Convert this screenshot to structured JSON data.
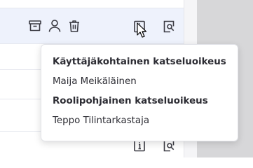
{
  "icons": {
    "archive": "archive-icon",
    "user": "user-icon",
    "delete": "trash-icon",
    "info": "info-icon",
    "preview": "document-search-icon",
    "cursor": "mouse-pointer-icon"
  },
  "popup": {
    "items": [
      {
        "label": "Käyttäjäkohtainen katseluoikeus",
        "bold": true
      },
      {
        "label": "Maija Meikäläinen",
        "bold": false
      },
      {
        "label": "Roolipohjainen katseluoikeus",
        "bold": true
      },
      {
        "label": "Teppo Tilintarkastaja",
        "bold": false
      }
    ]
  },
  "colors": {
    "row_highlight": "#eef2fc",
    "icon": "#3a3a42",
    "side_panel": "#d7d7d9"
  }
}
